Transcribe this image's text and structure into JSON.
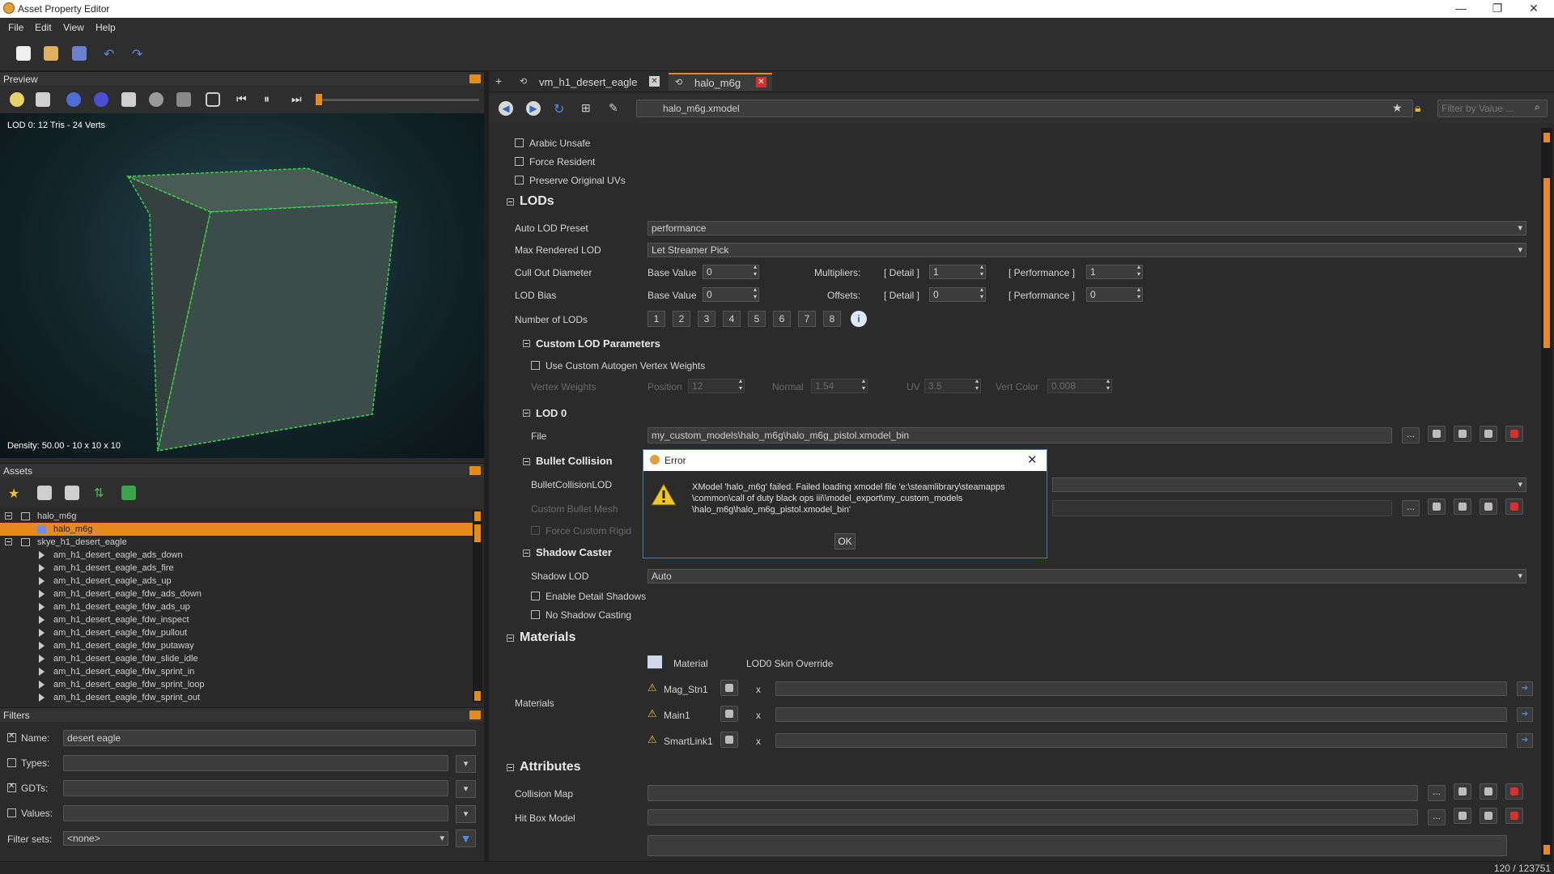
{
  "app": {
    "title": "Asset Property Editor"
  },
  "menu": [
    "File",
    "Edit",
    "View",
    "Help"
  ],
  "preview": {
    "title": "Preview",
    "lod_info": "LOD 0: 12 Tris - 24 Verts",
    "density": "Density: 50.00 - 10 x 10 x 10"
  },
  "assets": {
    "title": "Assets",
    "tree": [
      {
        "label": "halo_m6g",
        "level": 0
      },
      {
        "label": "halo_m6g",
        "level": 1,
        "selected": true
      },
      {
        "label": "skye_h1_desert_eagle",
        "level": 0
      },
      {
        "label": "am_h1_desert_eagle_ads_down",
        "level": 2
      },
      {
        "label": "am_h1_desert_eagle_ads_fire",
        "level": 2
      },
      {
        "label": "am_h1_desert_eagle_ads_up",
        "level": 2
      },
      {
        "label": "am_h1_desert_eagle_fdw_ads_down",
        "level": 2
      },
      {
        "label": "am_h1_desert_eagle_fdw_ads_up",
        "level": 2
      },
      {
        "label": "am_h1_desert_eagle_fdw_inspect",
        "level": 2
      },
      {
        "label": "am_h1_desert_eagle_fdw_pullout",
        "level": 2
      },
      {
        "label": "am_h1_desert_eagle_fdw_putaway",
        "level": 2
      },
      {
        "label": "am_h1_desert_eagle_fdw_slide_idle",
        "level": 2
      },
      {
        "label": "am_h1_desert_eagle_fdw_sprint_in",
        "level": 2
      },
      {
        "label": "am_h1_desert_eagle_fdw_sprint_loop",
        "level": 2
      },
      {
        "label": "am_h1_desert_eagle_fdw_sprint_out",
        "level": 2
      }
    ]
  },
  "filters": {
    "title": "Filters",
    "name_label": "Name:",
    "name_value": "desert eagle",
    "types_label": "Types:",
    "gdts_label": "GDTs:",
    "values_label": "Values:",
    "filtersets_label": "Filter sets:",
    "filtersets_value": "<none>"
  },
  "tabs": [
    {
      "label": "vm_h1_desert_eagle"
    },
    {
      "label": "halo_m6g",
      "active": true
    }
  ],
  "address": {
    "path": "halo_m6g.xmodel",
    "filter_placeholder": "Filter by Value ..."
  },
  "props": {
    "arabic_unsafe": "Arabic Unsafe",
    "force_resident": "Force Resident",
    "preserve_uvs": "Preserve Original UVs",
    "lods_section": "LODs",
    "auto_lod_label": "Auto LOD Preset",
    "auto_lod_value": "performance",
    "max_lod_label": "Max Rendered LOD",
    "max_lod_value": "Let Streamer Pick",
    "cull_label": "Cull Out Diameter",
    "lodbias_label": "LOD Bias",
    "base_value": "Base Value",
    "zero": "0",
    "one": "1",
    "multipliers": "Multipliers:",
    "offsets": "Offsets:",
    "detail": "[ Detail ]",
    "performance": "[ Performance ]",
    "num_lods_label": "Number of LODs",
    "lod_buttons": [
      "1",
      "2",
      "3",
      "4",
      "5",
      "6",
      "7",
      "8"
    ],
    "custom_lod_section": "Custom LOD Parameters",
    "use_custom_weights": "Use Custom Autogen Vertex Weights",
    "vertex_weights": "Vertex Weights",
    "position": "Position",
    "position_val": "12",
    "normal": "Normal",
    "normal_val": "1.54",
    "uv": "UV",
    "uv_val": "3.5",
    "vert_color": "Vert Color",
    "vert_color_val": "0.008",
    "lod0_section": "LOD 0",
    "file_label": "File",
    "file_value": "my_custom_models\\halo_m6g\\halo_m6g_pistol.xmodel_bin",
    "bullet_section": "Bullet Collision",
    "bullet_lod_label": "BulletCollisionLOD",
    "custom_bullet_mesh": "Custom Bullet Mesh",
    "force_custom_rigid": "Force Custom Rigid",
    "shadow_section": "Shadow Caster",
    "shadow_lod_label": "Shadow LOD",
    "shadow_lod_value": "Auto",
    "enable_detail_shadows": "Enable Detail Shadows",
    "no_shadow_casting": "No Shadow Casting",
    "materials_section": "Materials",
    "materials_label": "Materials",
    "material_col": "Material",
    "skin_col": "LOD0 Skin Override",
    "material_x": "x",
    "materials": [
      "Mag_Stn1",
      "Main1",
      "SmartLink1"
    ],
    "attributes_section": "Attributes",
    "collision_map": "Collision Map",
    "hit_box_model": "Hit Box Model"
  },
  "dialog": {
    "title": "Error",
    "message_line1": "XModel 'halo_m6g' failed.  Failed loading xmodel file 'e:\\steamlibrary\\steamapps",
    "message_line2": "\\common\\call of duty black ops iii\\\\model_export\\my_custom_models",
    "message_line3": "\\halo_m6g\\halo_m6g_pistol.xmodel_bin'",
    "ok": "OK"
  },
  "status": {
    "count": "120 / 123751"
  },
  "colors": {
    "accent": "#e58a1f",
    "background": "#2b2b2b",
    "error_red": "#d9302c",
    "dialog_border": "#4a79b5"
  },
  "icons": [
    "new-icon",
    "open-icon",
    "save-icon",
    "undo-icon",
    "redo-icon",
    "light-icon",
    "camera-icon",
    "play-icon",
    "pause-icon",
    "warning-icon",
    "star-icon",
    "lock-icon",
    "search-icon",
    "info-icon"
  ]
}
